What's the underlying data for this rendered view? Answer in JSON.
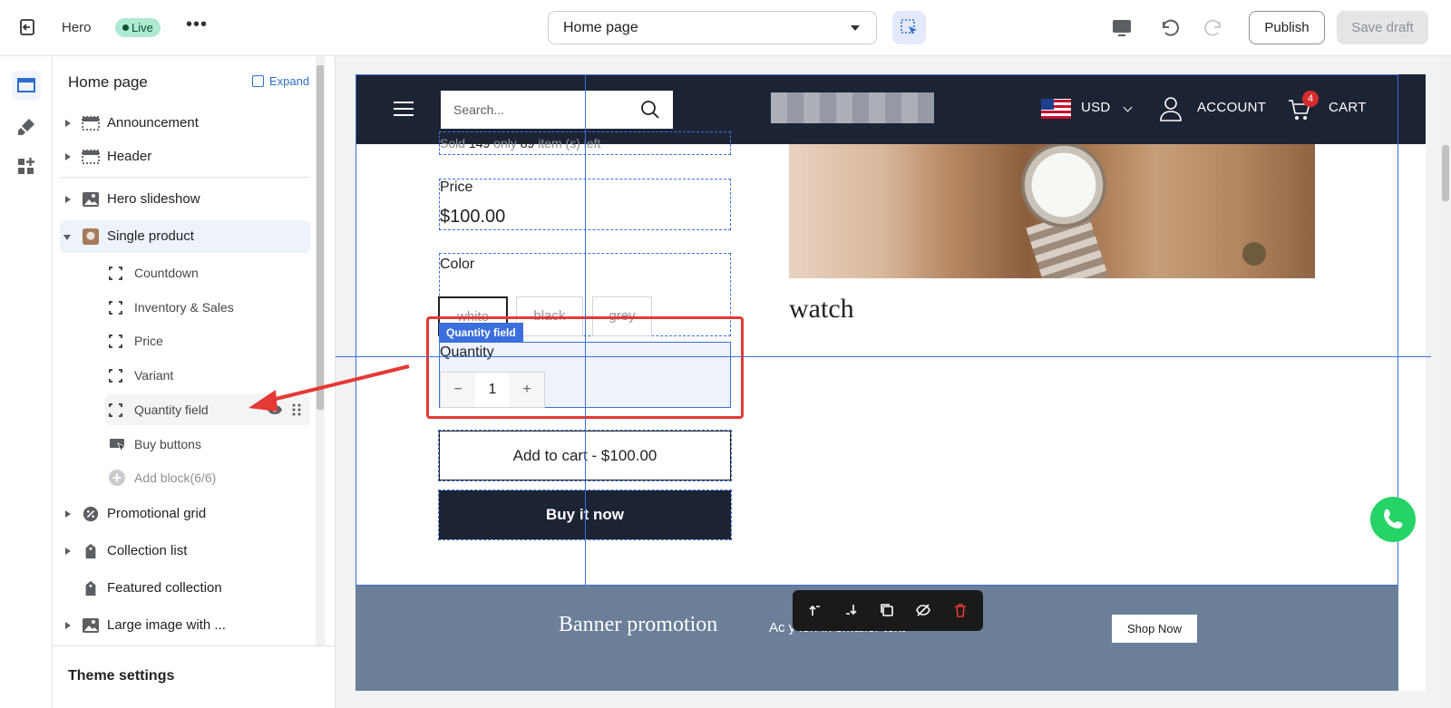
{
  "topbar": {
    "store_name": "Hero",
    "status_badge": "Live",
    "more_label": "•••",
    "page_select": "Home page",
    "publish_label": "Publish",
    "save_draft_label": "Save draft"
  },
  "sidebar": {
    "title": "Home page",
    "expand_label": "Expand",
    "sections": [
      {
        "label": "Announcement"
      },
      {
        "label": "Header"
      },
      {
        "label": "Hero slideshow"
      },
      {
        "label": "Single product"
      },
      {
        "label": "Promotional grid"
      },
      {
        "label": "Collection list"
      },
      {
        "label": "Featured collection"
      },
      {
        "label": "Large image with ..."
      }
    ],
    "blocks": [
      {
        "label": "Countdown"
      },
      {
        "label": "Inventory & Sales"
      },
      {
        "label": "Price"
      },
      {
        "label": "Variant"
      },
      {
        "label": "Quantity field"
      },
      {
        "label": "Buy buttons"
      }
    ],
    "add_block_label": "Add block(6/6)",
    "footer_label": "Theme settings"
  },
  "preview": {
    "search_placeholder": "Search...",
    "currency": "USD",
    "account_label": "ACCOUNT",
    "cart_label": "CART",
    "cart_count": "4",
    "sold_prefix": "Sold ",
    "sold_count": "149",
    "sold_mid": " only ",
    "left_count": "89",
    "sold_suffix": " item  (s)  left",
    "price_heading": "Price",
    "price_value": "$100.00",
    "color_heading": "Color",
    "colors": [
      "white",
      "black",
      "grey"
    ],
    "qty_tag": "Quantity field",
    "qty_heading": "Quantity",
    "qty_minus": "−",
    "qty_value": "1",
    "qty_plus": "+",
    "add_to_cart": "Add to cart - $100.00",
    "buy_now": "Buy it now",
    "product_title": "watch",
    "banner_title": "Banner promotion",
    "banner_sub": "Ac                    y            ion in smaller text",
    "banner_button": "Shop Now"
  },
  "colors": {
    "accent": "#3b6fde",
    "annotation": "#e53935",
    "store_header": "#1c2434",
    "banner": "#6b7f99"
  }
}
